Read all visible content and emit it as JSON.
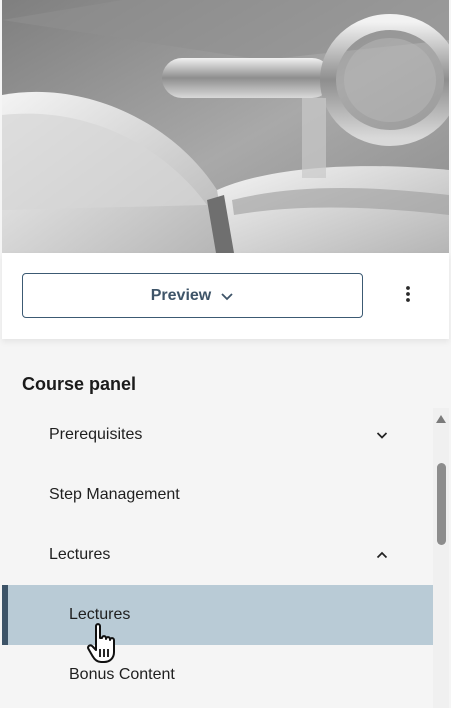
{
  "hero": {
    "image": "course-cover-image"
  },
  "toolbar": {
    "preview_label": "Preview",
    "preview_icon": "chevron-down-icon",
    "more_icon": "more-vertical-icon"
  },
  "course_panel": {
    "title": "Course panel",
    "items": [
      {
        "label": "Prerequisites",
        "level": 1,
        "icon": "chevron-down-icon"
      },
      {
        "label": "Step Management",
        "level": 1
      },
      {
        "label": "Lectures",
        "level": 1,
        "icon": "chevron-up-icon",
        "expanded": true
      },
      {
        "label": "Lectures",
        "level": 2,
        "active": true
      },
      {
        "label": "Bonus Content",
        "level": 2
      }
    ]
  },
  "colors": {
    "accent": "#3d5468",
    "active_bg": "#b9cbd6"
  }
}
